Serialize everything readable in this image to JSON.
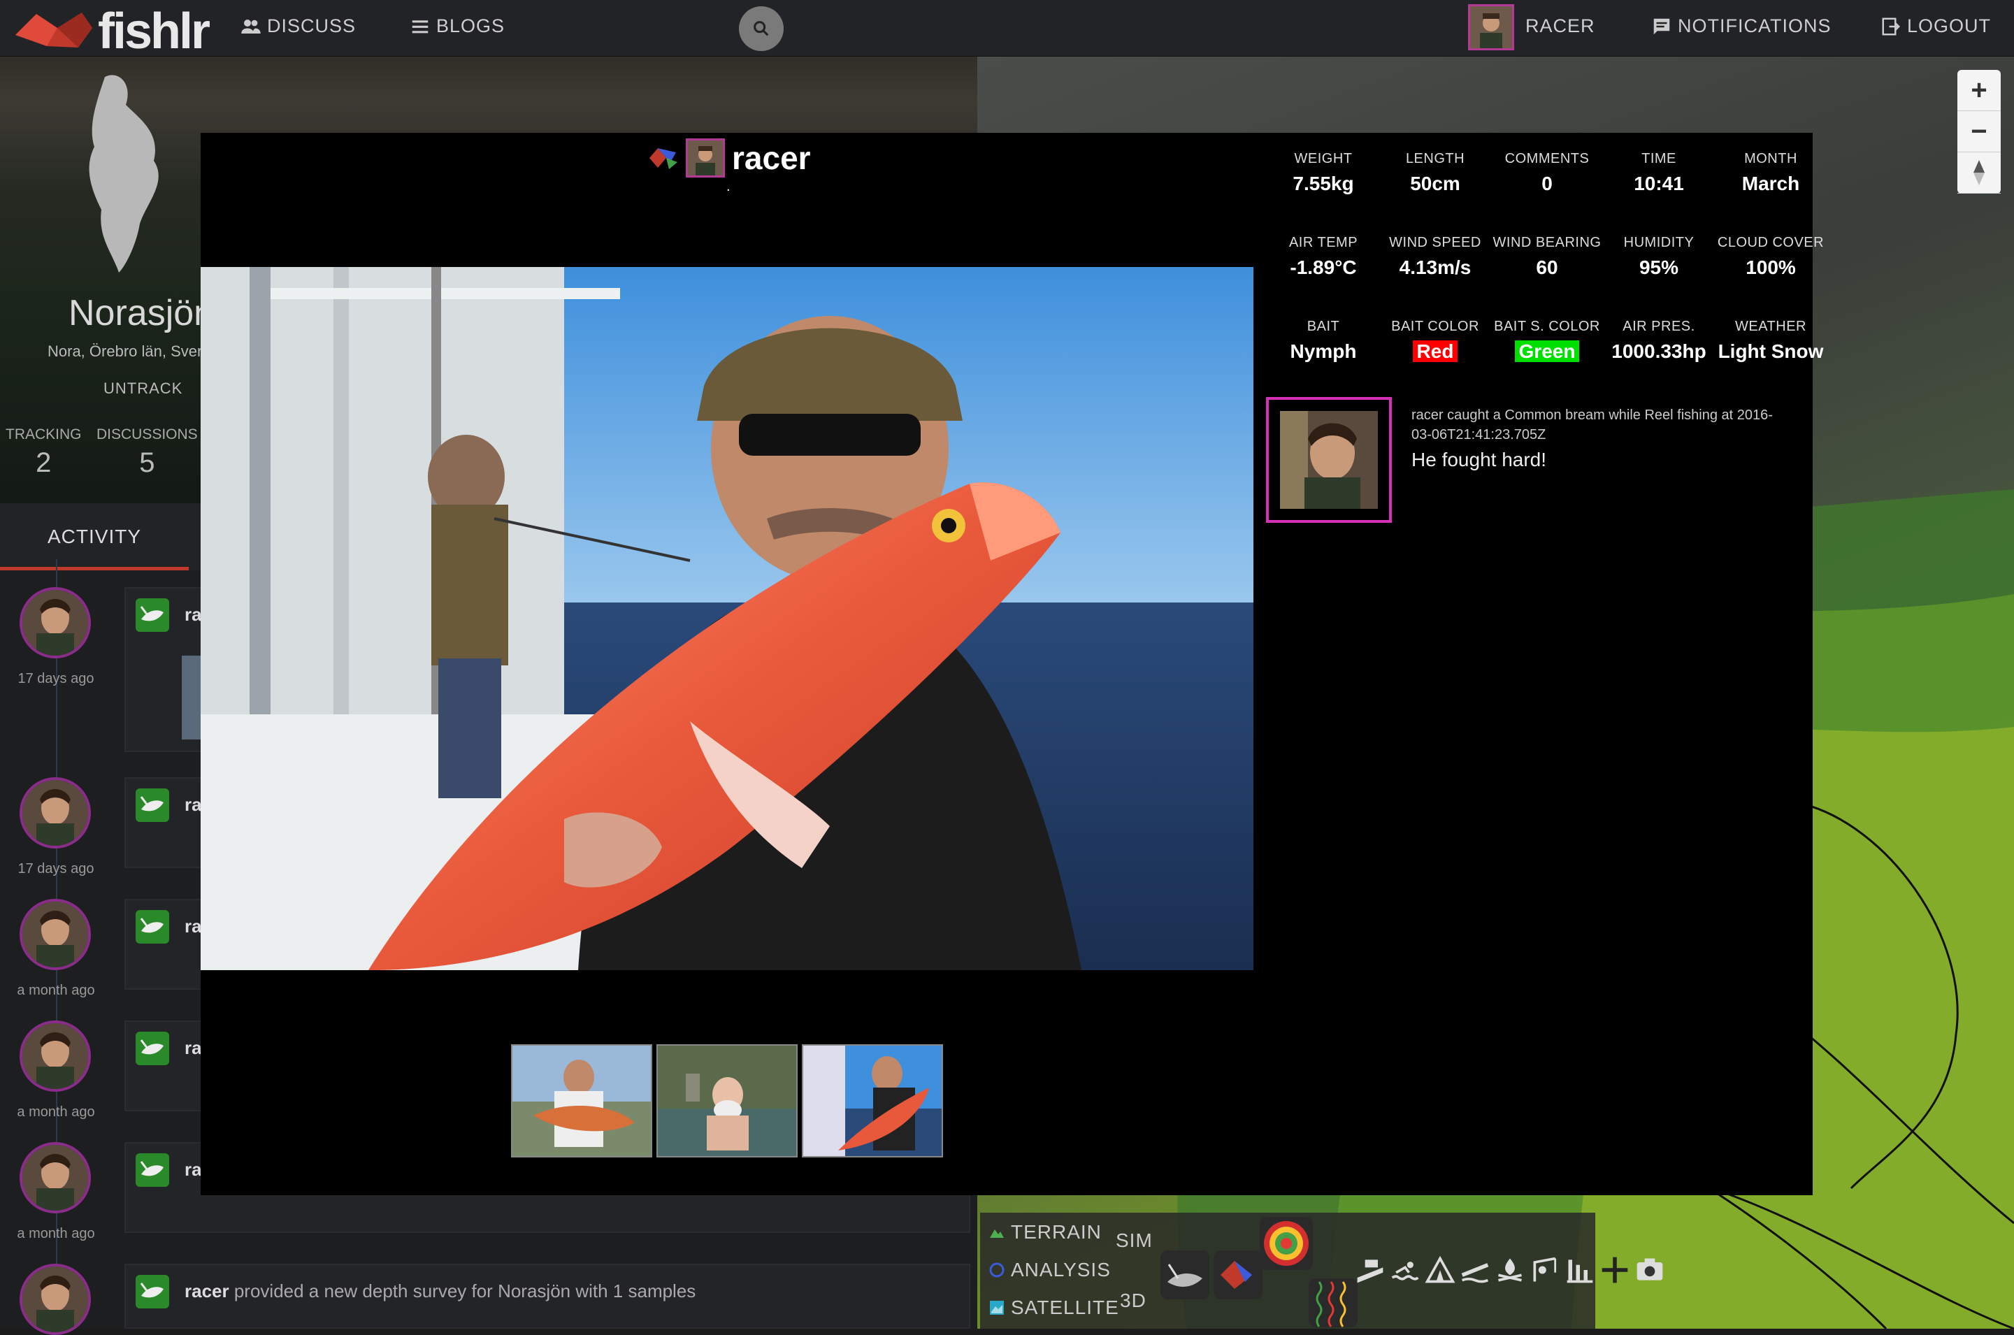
{
  "nav": {
    "logo_text": "fishlr",
    "discuss": "DISCUSS",
    "blogs": "BLOGS",
    "user": "RACER",
    "notifications": "NOTIFICATIONS",
    "logout": "LOGOUT"
  },
  "profile": {
    "title": "Norasjön",
    "subtitle": "Nora, Örebro län, Sverige",
    "untrack": "UNTRACK",
    "tracking_label": "TRACKING",
    "tracking_count": "2",
    "discussions_label": "DISCUSSIONS",
    "discussions_count": "5",
    "tab_activity": "ACTIVITY"
  },
  "activity": [
    {
      "time": "17 days ago",
      "text_prefix": "ra",
      "text_rest": ""
    },
    {
      "time": "17 days ago",
      "text_prefix": "ra",
      "text_rest": ""
    },
    {
      "time": "a month ago",
      "text_prefix": "ra",
      "text_rest": ""
    },
    {
      "time": "a month ago",
      "text_prefix": "ra",
      "text_rest": ""
    },
    {
      "time": "a month ago",
      "text_prefix": "ra",
      "text_rest": ""
    },
    {
      "time": "",
      "text_prefix": "racer",
      "text_rest": " provided a new depth survey for Norasjön with 1 samples"
    }
  ],
  "map": {
    "layers": {
      "terrain": "TERRAIN",
      "analysis": "ANALYSIS",
      "satellite": "SATELLITE",
      "sim": "SIM",
      "d3": "3D"
    },
    "zoom_in": "+",
    "zoom_out": "−"
  },
  "modal": {
    "username": "racer",
    "dot": ".",
    "stats": [
      {
        "label": "WEIGHT",
        "value": "7.55kg"
      },
      {
        "label": "LENGTH",
        "value": "50cm"
      },
      {
        "label": "COMMENTS",
        "value": "0"
      },
      {
        "label": "TIME",
        "value": "10:41"
      },
      {
        "label": "MONTH",
        "value": "March"
      },
      {
        "label": "AIR TEMP",
        "value": "-1.89°C"
      },
      {
        "label": "WIND SPEED",
        "value": "4.13m/s"
      },
      {
        "label": "WIND BEARING",
        "value": "60"
      },
      {
        "label": "HUMIDITY",
        "value": "95%"
      },
      {
        "label": "CLOUD COVER",
        "value": "100%"
      },
      {
        "label": "BAIT",
        "value": "Nymph"
      },
      {
        "label": "BAIT COLOR",
        "value": "Red"
      },
      {
        "label": "BAIT S. COLOR",
        "value": "Green"
      },
      {
        "label": "AIR PRES.",
        "value": "1000.33hp"
      },
      {
        "label": "WEATHER",
        "value": "Light Snow"
      }
    ],
    "bait_color_hex": "#ff0000",
    "bait_s_color_hex": "#00e000",
    "comment_meta": "racer caught a Common bream while Reel fishing at 2016-03-06T21:41:23.705Z",
    "comment_text": "He fought hard!"
  },
  "colors": {
    "accent": "#c0392b",
    "avatar_border": "#b23a94",
    "comment_border": "#d630b8"
  }
}
